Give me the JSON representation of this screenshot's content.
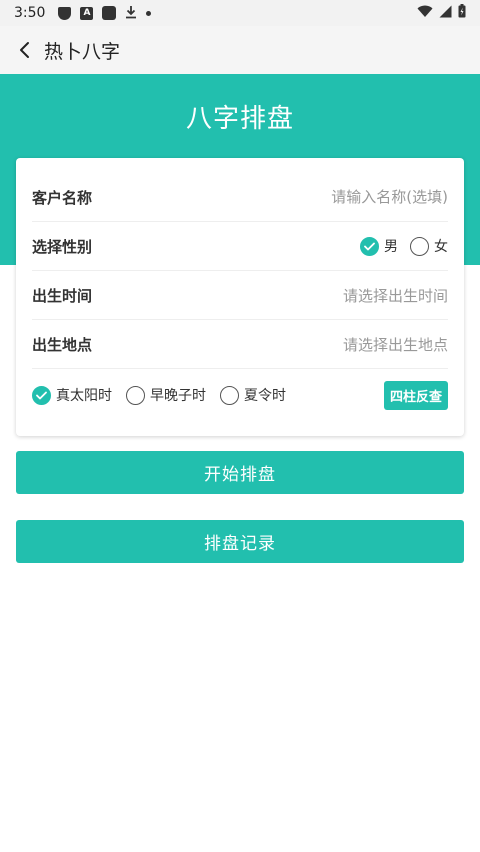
{
  "status_bar": {
    "time": "3:50",
    "left_icons": [
      "shield-icon",
      "a-box-icon",
      "square-icon",
      "download-icon",
      "dot-icon"
    ],
    "right_icons": [
      "wifi-icon",
      "signal-icon",
      "battery-icon"
    ]
  },
  "app_bar": {
    "title": "热卜八字"
  },
  "page": {
    "title": "八字排盘"
  },
  "form": {
    "name_label": "客户名称",
    "name_placeholder": "请输入名称(选填)",
    "gender_label": "选择性别",
    "gender_options": [
      "男",
      "女"
    ],
    "gender_selected": "男",
    "birth_time_label": "出生时间",
    "birth_time_placeholder": "请选择出生时间",
    "birth_place_label": "出生地点",
    "birth_place_placeholder": "请选择出生地点",
    "time_options": [
      "真太阳时",
      "早晚子时",
      "夏令时"
    ],
    "time_selected": "真太阳时",
    "reverse_lookup_label": "四柱反查"
  },
  "actions": {
    "start_label": "开始排盘",
    "records_label": "排盘记录"
  },
  "colors": {
    "accent": "#22bfae",
    "header_bg": "#22bfae",
    "app_bar_bg": "#f5f5f5"
  }
}
